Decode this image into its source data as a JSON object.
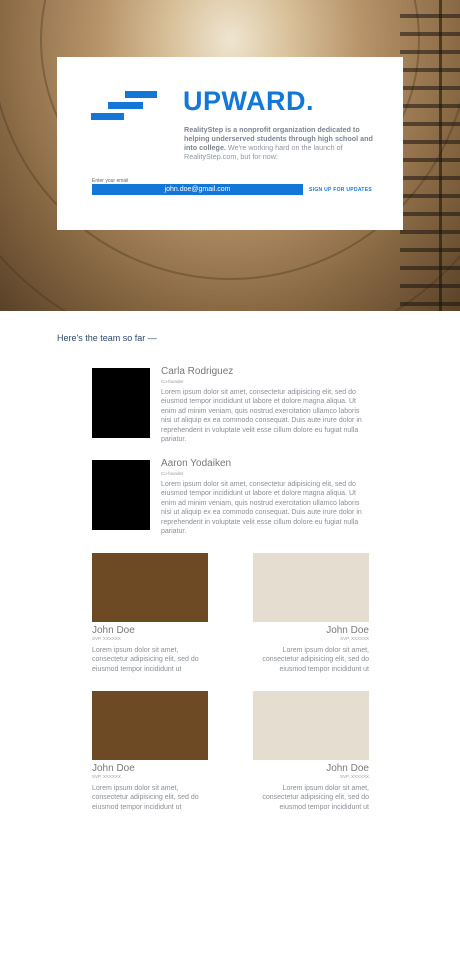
{
  "hero": {
    "brand": "UPWARD.",
    "intro_bold": "RealityStep is a nonprofit organization dedicated to helping underserved students through high school and into college.",
    "intro_rest": " We're working hard on the launch of RealityStep.com, but for now:",
    "email_label": "Enter your email",
    "email_value": "john.doe@gmail.com",
    "signup_label": "SIGN UP FOR UPDATES",
    "colors": {
      "accent": "#1377d8"
    }
  },
  "team": {
    "heading": "Here's the team so far —",
    "featured": [
      {
        "name": "Carla Rodriguez",
        "role": "Co-founder",
        "photo_color": "#000000",
        "bio": "Lorem ipsum dolor sit amet, consectetur adipisicing elit, sed do eiusmod tempor incididunt ut labore et dolore magna aliqua. Ut enim ad minim veniam, quis nostrud exercitation ullamco laboris nisi ut aliquip ex ea commodo consequat. Duis aute irure dolor in reprehenderit in voluptate velit esse cillum dolore eu fugiat nulla pariatur."
      },
      {
        "name": "Aaron Yodaiken",
        "role": "Co-founder",
        "photo_color": "#000000",
        "bio": "Lorem ipsum dolor sit amet, consectetur adipisicing elit, sed do eiusmod tempor incididunt ut labore et dolore magna aliqua. Ut enim ad minim veniam, quis nostrud exercitation ullamco laboris nisi ut aliquip ex ea commodo consequat. Duis aute irure dolor in reprehenderit in voluptate velit esse cillum dolore eu fugiat nulla pariatur."
      }
    ],
    "members": [
      {
        "name": "John Doe",
        "role": "SVP, XXXXXX",
        "photo_color": "#6e4a24",
        "bio": "Lorem ipsum dolor sit amet, consectetur adipisicing elit, sed do eiusmod tempor incididunt ut"
      },
      {
        "name": "John Doe",
        "role": "SVP, XXXXXX",
        "photo_color": "#e4ddd0",
        "bio": "Lorem ipsum dolor sit amet, consectetur adipisicing elit, sed do eiusmod tempor incididunt ut"
      },
      {
        "name": "John Doe",
        "role": "SVP, XXXXXX",
        "photo_color": "#6e4a24",
        "bio": "Lorem ipsum dolor sit amet, consectetur adipisicing elit, sed do eiusmod tempor incididunt ut"
      },
      {
        "name": "John Doe",
        "role": "SVP, XXXXXX",
        "photo_color": "#e4ddd0",
        "bio": "Lorem ipsum dolor sit amet, consectetur adipisicing elit, sed do eiusmod tempor incididunt ut"
      }
    ]
  }
}
